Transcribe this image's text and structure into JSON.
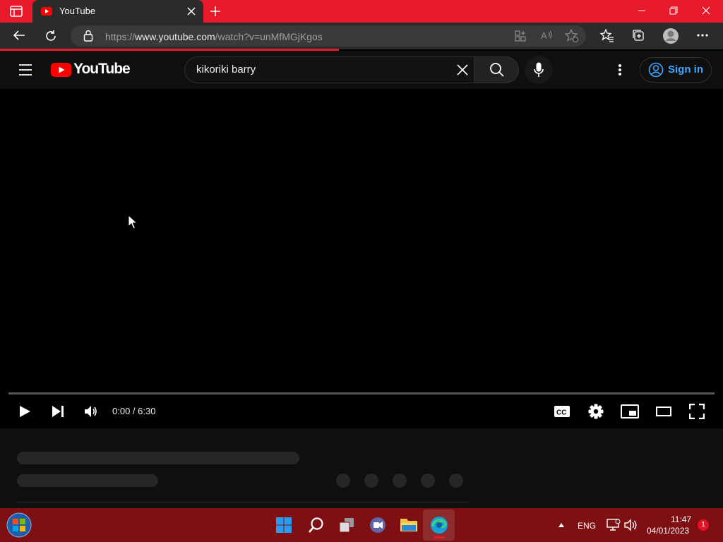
{
  "browser": {
    "tab_title": "YouTube",
    "url_prefix": "https://",
    "url_host": "www.youtube.com",
    "url_path": "/watch?v=unMfMGjKgos"
  },
  "youtube": {
    "logo_text": "YouTube",
    "search_query": "kikoriki barry",
    "signin_label": "Sign in"
  },
  "player": {
    "current_time": "0:00",
    "duration": "6:30",
    "time_display": "0:00 / 6:30",
    "progress": 0
  },
  "taskbar": {
    "language": "ENG",
    "time": "11:47",
    "date": "04/01/2023",
    "notification_count": "1"
  },
  "colors": {
    "accent_red": "#e8192a",
    "taskbar": "#7e0f12",
    "link_blue": "#3ea6ff"
  }
}
